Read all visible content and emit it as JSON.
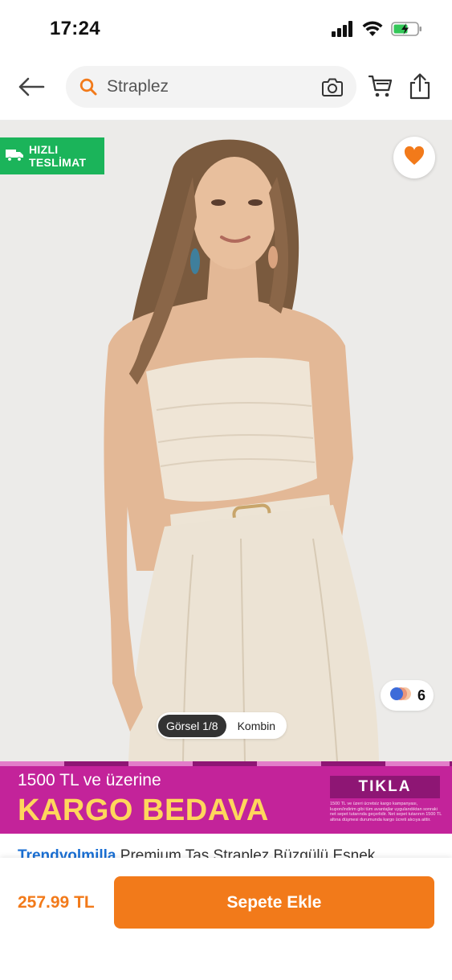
{
  "status_bar": {
    "time": "17:24",
    "icons": [
      "signal-icon",
      "wifi-icon",
      "battery-charging-icon"
    ]
  },
  "header": {
    "back_icon": "arrow-left-icon",
    "search": {
      "value": "Straplez",
      "icon": "search-icon",
      "camera_icon": "camera-icon"
    },
    "cart_icon": "cart-icon",
    "share_icon": "share-icon"
  },
  "product_image": {
    "badge": {
      "line1": "HIZLI",
      "line2": "TESLİMAT",
      "icon": "truck-icon"
    },
    "favorite_icon": "heart-icon",
    "color_count": "6",
    "tabs": [
      {
        "label": "Görsel 1/8",
        "active": true
      },
      {
        "label": "Kombin",
        "active": false
      }
    ]
  },
  "promo": {
    "line1": "1500 TL ve üzerine",
    "line2": "KARGO BEDAVA",
    "cta": "TIKLA",
    "fine_print": "1500 TL ve üzeri ücretsiz kargo kampanyası, kupon/indirim gibi tüm avantajlar uygulandıktan sonraki net sepet tutarında geçerlidir. Net sepet tutarının 1500 TL altına düşmesi durumunda kargo ücreti alıcıya aittir."
  },
  "product": {
    "brand": "Trendyolmilla",
    "title": "Premium Taş Straplez Büzgülü Esnek"
  },
  "bottom_bar": {
    "price": "257.99 TL",
    "add_to_cart": "Sepete Ekle"
  },
  "colors": {
    "accent": "#f27a1a",
    "badge_green": "#1bb45a",
    "promo_magenta": "#c3239a",
    "promo_yellow": "#ffd65c"
  }
}
